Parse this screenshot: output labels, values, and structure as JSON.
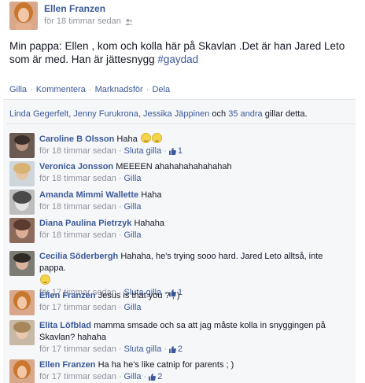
{
  "post": {
    "author": "Ellen Franzen",
    "time": "för 18 timmar sedan",
    "text_main": "Min pappa: Ellen , kom och kolla här på Skavlan .Det är han Jared Leto som är med. Han är jättesnygg ",
    "hashtag": "#gaydad"
  },
  "actions": {
    "like": "Gilla",
    "comment": "Kommentera",
    "promote": "Marknadsför",
    "share": "Dela"
  },
  "likes_summary": {
    "names": "Linda Gegerfelt, Jenny Furukrona, Jessika Jäppinen",
    "and": " och ",
    "others": "35 andra",
    "suffix": " gillar detta."
  },
  "comments": [
    {
      "author": "Caroline B Olsson",
      "text": "Haha",
      "emoji_count": 2,
      "time": "för 18 timmar sedan",
      "action": "Sluta gilla",
      "likes": "1"
    },
    {
      "author": "Veronica Jonsson",
      "text": "MEEEEN ahahahahahahahah",
      "time": "för 18 timmar sedan",
      "action": "Gilla"
    },
    {
      "author": "Amanda Mimmi Wallette",
      "text": "Haha",
      "time": "för 18 timmar sedan",
      "action": "Gilla"
    },
    {
      "author": "Diana Paulina Pietrzyk",
      "text": "Hahaha",
      "time": "för 18 timmar sedan",
      "action": "Gilla"
    },
    {
      "author": "Cecilia Söderbergh",
      "text": "Hahaha, he's trying sooo hard. Jared Leto alltså, inte pappa.",
      "emoji_count": 1,
      "time": "för 17 timmar sedan",
      "action": "Sluta gilla",
      "likes": "1"
    },
    {
      "author": "Ellen Franzen",
      "text": "Jesus is that you ? ; )",
      "time": "för 17 timmar sedan",
      "action": "Gilla"
    },
    {
      "author": "Elita Löfblad",
      "text": "mamma smsade och sa att jag måste kolla in snyggingen på Skavlan? hahaha",
      "time": "för 17 timmar sedan",
      "action": "Sluta gilla",
      "likes": "2"
    },
    {
      "author": "Ellen Franzen",
      "text": "Ha ha he's like catnip for parents ; )",
      "time": "för 17 timmar sedan",
      "action": "Gilla",
      "likes": "2"
    }
  ],
  "colors": {
    "link": "#3b5998",
    "meta": "#90949c",
    "ufi_bg": "#f6f7f9"
  }
}
